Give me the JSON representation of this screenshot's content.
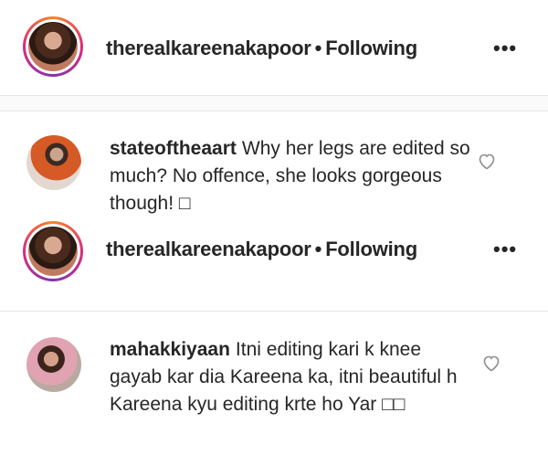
{
  "post1": {
    "author": "therealkareenakapoor",
    "separator": "•",
    "follow_status": "Following",
    "more_label": "•••",
    "comment": {
      "username": "stateoftheaart",
      "text": "Why her legs are edited so much? No offence, she looks gorgeous though! □"
    }
  },
  "post2": {
    "author": "therealkareenakapoor",
    "separator": "•",
    "follow_status": "Following",
    "more_label": "•••",
    "comment": {
      "username": "mahakkiyaan",
      "text": "Itni editing kari k knee gayab kar dia Kareena ka, itni beautiful h Kareena kyu editing krte ho Yar □□"
    }
  },
  "icons": {
    "like": "heart-outline-icon",
    "more": "more-options-icon"
  },
  "colors": {
    "text": "#262626",
    "divider": "#e6e6e6",
    "story_ring": [
      "#f58529",
      "#dd2a7b",
      "#8134af"
    ]
  }
}
